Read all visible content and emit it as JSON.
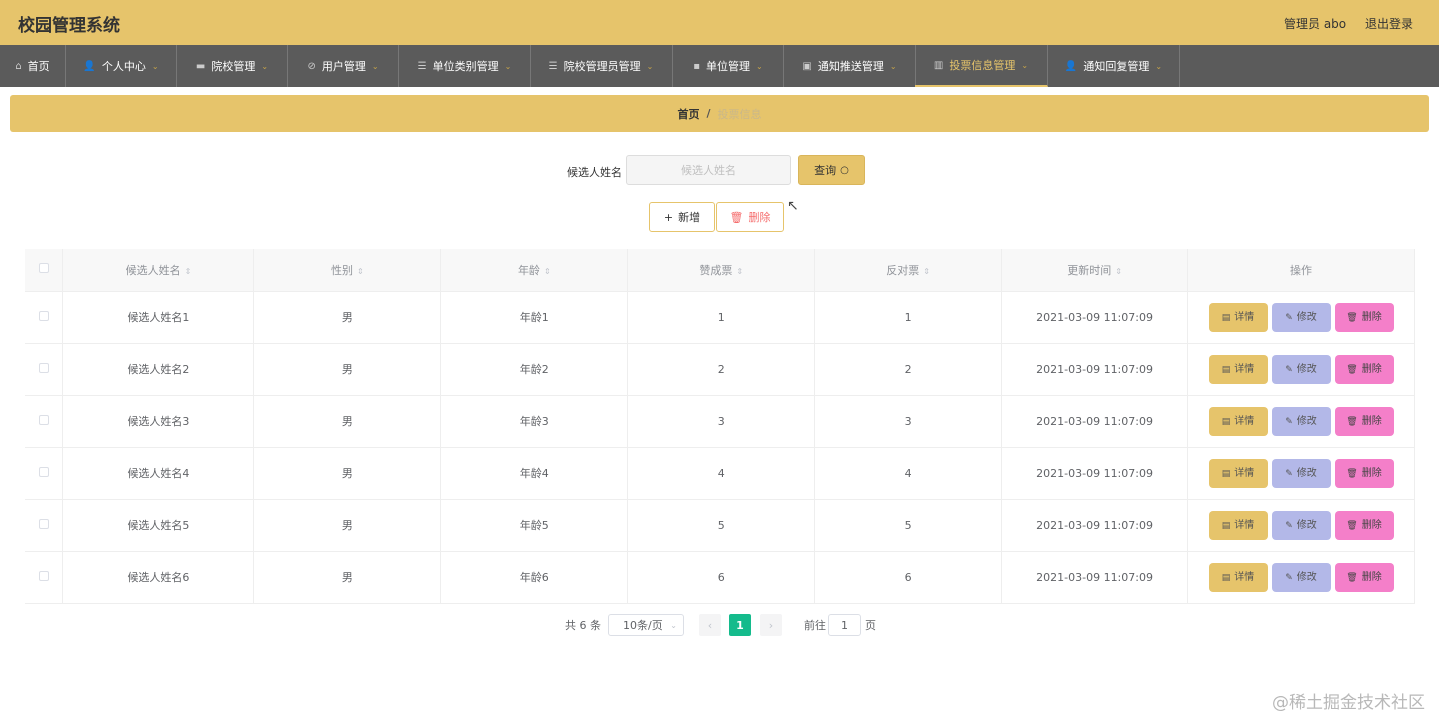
{
  "app": {
    "title": "校园管理系统",
    "user": "管理员 abo",
    "logout": "退出登录"
  },
  "nav": [
    {
      "label": "首页",
      "icon": "home-icon",
      "glyph": "⌂",
      "chev": ""
    },
    {
      "label": "个人中心",
      "icon": "person-icon",
      "glyph": "👤",
      "chev": "⌄"
    },
    {
      "label": "院校管理",
      "icon": "school-icon",
      "glyph": "▬",
      "chev": "⌄"
    },
    {
      "label": "用户管理",
      "icon": "user-icon",
      "glyph": "⊘",
      "chev": "⌄"
    },
    {
      "label": "单位类别管理",
      "icon": "list-icon",
      "glyph": "☰",
      "chev": "⌄"
    },
    {
      "label": "院校管理员管理",
      "icon": "list-icon",
      "glyph": "☰",
      "chev": "⌄"
    },
    {
      "label": "单位管理",
      "icon": "chart-icon",
      "glyph": "▪",
      "chev": "⌄"
    },
    {
      "label": "通知推送管理",
      "icon": "briefcase-icon",
      "glyph": "▣",
      "chev": "⌄"
    },
    {
      "label": "投票信息管理",
      "icon": "bar-chart-icon",
      "glyph": "▥",
      "chev": "⌄"
    },
    {
      "label": "通知回复管理",
      "icon": "person-icon",
      "glyph": "👤",
      "chev": "⌄"
    }
  ],
  "breadcrumb": {
    "home": "首页",
    "sep": "/",
    "current": "投票信息"
  },
  "search": {
    "label": "候选人姓名",
    "placeholder": "候选人姓名",
    "query": "查询",
    "query_icon": "○"
  },
  "actions": {
    "add": "新增",
    "add_icon": "+",
    "delete": "删除",
    "delete_icon": "🗑"
  },
  "table": {
    "headers": [
      "候选人姓名",
      "性别",
      "年龄",
      "赞成票",
      "反对票",
      "更新时间",
      "操作"
    ],
    "sort_glyph": "⇕",
    "rows": [
      [
        "候选人姓名1",
        "男",
        "年龄1",
        "1",
        "1",
        "2021-03-09 11:07:09"
      ],
      [
        "候选人姓名2",
        "男",
        "年龄2",
        "2",
        "2",
        "2021-03-09 11:07:09"
      ],
      [
        "候选人姓名3",
        "男",
        "年龄3",
        "3",
        "3",
        "2021-03-09 11:07:09"
      ],
      [
        "候选人姓名4",
        "男",
        "年龄4",
        "4",
        "4",
        "2021-03-09 11:07:09"
      ],
      [
        "候选人姓名5",
        "男",
        "年龄5",
        "5",
        "5",
        "2021-03-09 11:07:09"
      ],
      [
        "候选人姓名6",
        "男",
        "年龄6",
        "6",
        "6",
        "2021-03-09 11:07:09"
      ]
    ],
    "ops": {
      "detail": "详情",
      "edit": "修改",
      "delete": "删除",
      "detail_icon": "▤",
      "edit_icon": "✎",
      "delete_icon": "🗑"
    }
  },
  "pagination": {
    "total": "共 6 条",
    "size": "10条/页",
    "page": "1",
    "goto": "前往",
    "goto_value": "1",
    "suffix": "页",
    "prev": "‹",
    "next": "›",
    "dropdown": "⌄"
  },
  "watermark": "@稀土掘金技术社区",
  "colors": {
    "header": "#e6c46b",
    "nav": "#5b5b5b",
    "page_active": "#14bb8c",
    "detail": "#e6c46b",
    "edit": "#b3b8e8",
    "delete": "#f47fc9"
  }
}
